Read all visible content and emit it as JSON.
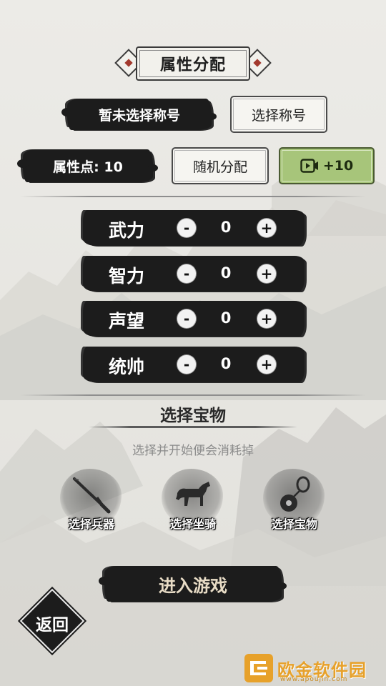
{
  "header": {
    "title": "属性分配"
  },
  "title_section": {
    "current_title": "暂未选择称号",
    "select_title_button": "选择称号"
  },
  "points_section": {
    "points_label": "属性点: 10",
    "random_button": "随机分配",
    "ad_bonus_button": "+10",
    "ad_icon": "video-play-icon"
  },
  "stats": [
    {
      "label": "武力",
      "value": "0"
    },
    {
      "label": "智力",
      "value": "0"
    },
    {
      "label": "声望",
      "value": "0"
    },
    {
      "label": "统帅",
      "value": "0"
    }
  ],
  "stat_controls": {
    "minus": "-",
    "plus": "+"
  },
  "treasure": {
    "title": "选择宝物",
    "subtitle": "选择并开始便会消耗掉",
    "options": [
      {
        "label": "选择兵器",
        "icon": "sword-icon"
      },
      {
        "label": "选择坐骑",
        "icon": "horse-icon"
      },
      {
        "label": "选择宝物",
        "icon": "jade-pendant-icon"
      }
    ]
  },
  "enter_button": "进入游戏",
  "back_button": "返回",
  "watermark": {
    "text": "欧金软件园",
    "url": "www.apoujin.com"
  },
  "colors": {
    "background": "#ecebe7",
    "ink": "#1c1c1c",
    "accent_red": "#a33a2e",
    "bonus_green": "#a7c57a",
    "watermark_orange": "#e7a12a"
  }
}
